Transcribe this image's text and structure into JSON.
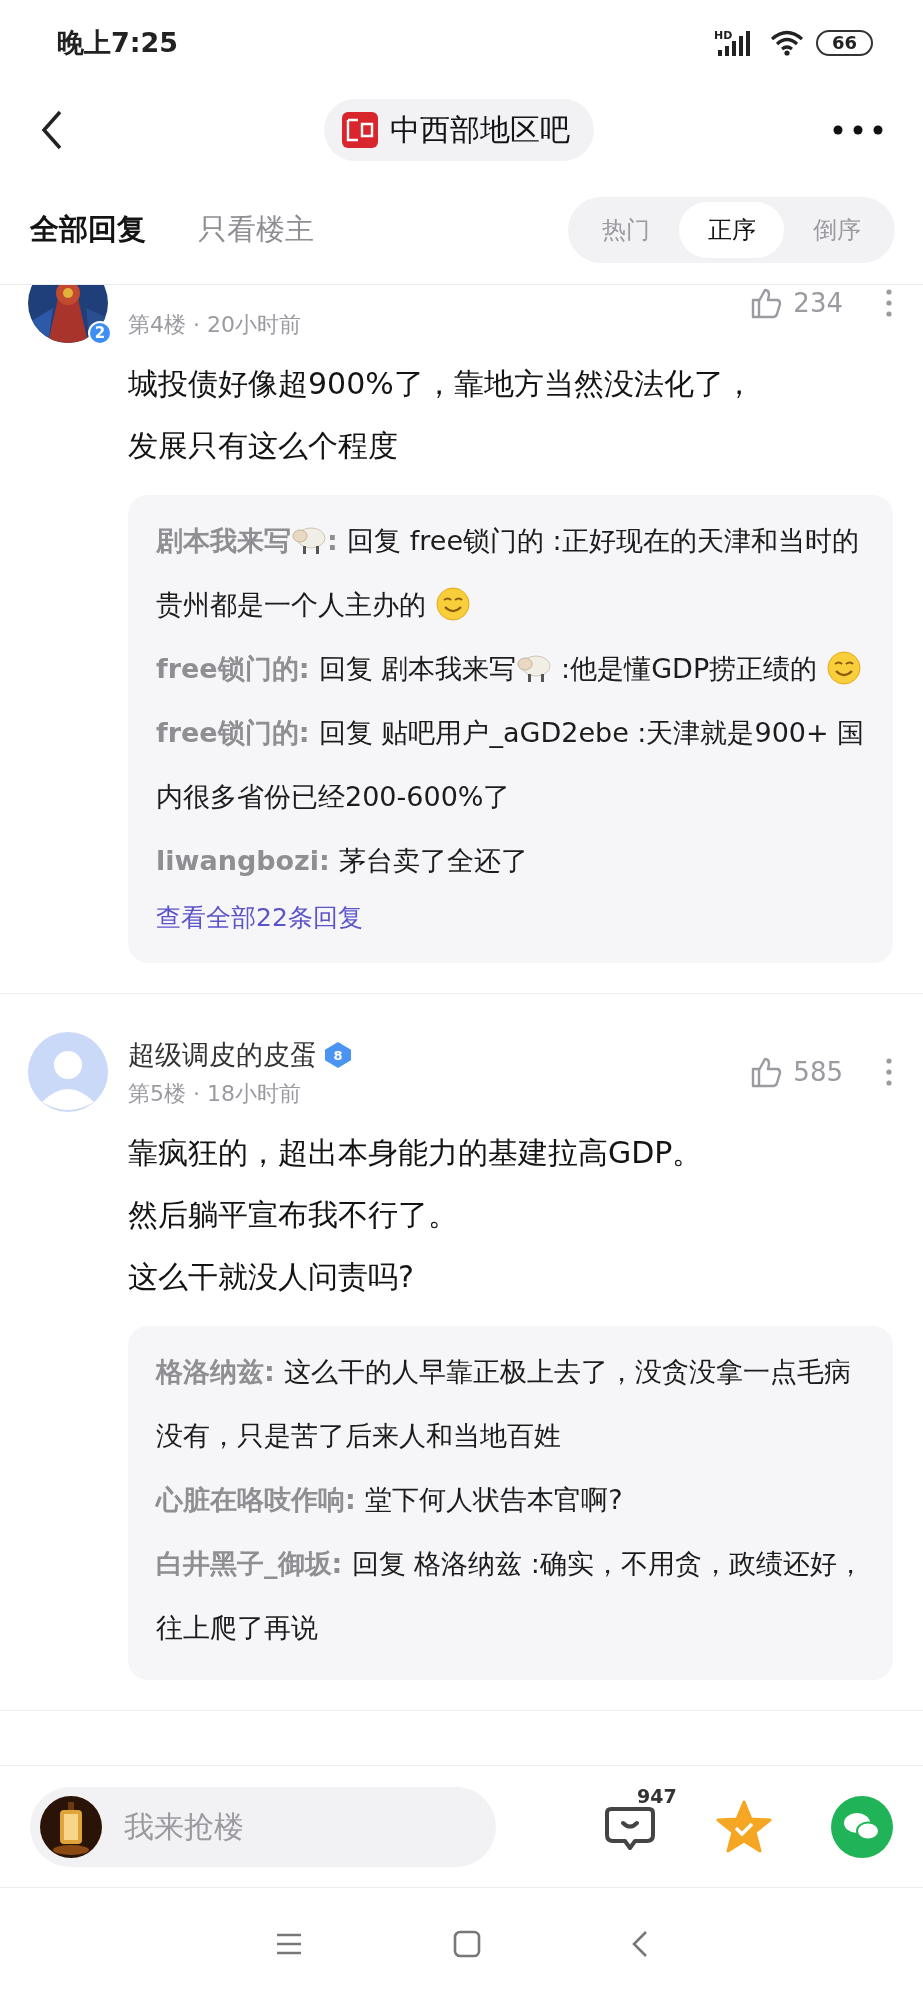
{
  "status_bar": {
    "time": "晚上7:25",
    "network": "HD",
    "battery": "66"
  },
  "nav": {
    "title": "中西部地区吧"
  },
  "tabs": [
    {
      "label": "全部回复",
      "selected": true
    },
    {
      "label": "只看楼主",
      "selected": false
    }
  ],
  "sort": [
    {
      "label": "热门",
      "selected": false
    },
    {
      "label": "正序",
      "selected": true
    },
    {
      "label": "倒序",
      "selected": false
    }
  ],
  "posts": [
    {
      "avatar": {
        "kind": "picture"
      },
      "level": "2",
      "meta": "第4楼 · 20小时前",
      "likes": "234",
      "body": [
        "城投债好像超900%了，靠地方当然没法化了，",
        "发展只有这么个程度"
      ],
      "replies": [
        [
          {
            "kind": "author",
            "text": "剧本我来写"
          },
          {
            "kind": "sheep"
          },
          {
            "kind": "author",
            "text": ": "
          },
          {
            "kind": "text",
            "text": "回复 free锁门的 :正好现在的天津和当时的贵州都是一个人主办的 "
          },
          {
            "kind": "smile"
          }
        ],
        [
          {
            "kind": "author",
            "text": "free锁门的: "
          },
          {
            "kind": "text",
            "text": "回复 剧本我来写"
          },
          {
            "kind": "sheep"
          },
          {
            "kind": "text",
            "text": " :他是懂GDP捞正绩的 "
          },
          {
            "kind": "smile"
          }
        ],
        [
          {
            "kind": "author",
            "text": "free锁门的: "
          },
          {
            "kind": "text",
            "text": "回复 贴吧用户_aGD2ebe :天津就是900+ 国内很多省份已经200-600%了"
          }
        ],
        [
          {
            "kind": "author",
            "text": "liwangbozi: "
          },
          {
            "kind": "text",
            "text": "茅台卖了全还了"
          }
        ]
      ],
      "more": "查看全部22条回复"
    },
    {
      "avatar": {
        "kind": "silhouette"
      },
      "name": "超级调皮的皮蛋",
      "badge": "8",
      "meta": "第5楼 · 18小时前",
      "likes": "585",
      "body": [
        "靠疯狂的，超出本身能力的基建拉高GDP。",
        "然后躺平宣布我不行了。",
        "这么干就没人问责吗?"
      ],
      "replies": [
        [
          {
            "kind": "author",
            "text": "格洛纳兹: "
          },
          {
            "kind": "text",
            "text": "这么干的人早靠正极上去了，没贪没拿一点毛病没有，只是苦了后来人和当地百姓"
          }
        ],
        [
          {
            "kind": "author",
            "text": "心脏在咯吱作响: "
          },
          {
            "kind": "text",
            "text": "堂下何人状告本官啊?"
          }
        ],
        [
          {
            "kind": "author",
            "text": "白井黑子_御坂: "
          },
          {
            "kind": "text",
            "text": "回复 格洛纳兹 :确实，不用贪，政绩还好，往上爬了再说"
          }
        ]
      ]
    }
  ],
  "composer": {
    "placeholder": "我来抢楼",
    "comment_count": "947"
  }
}
